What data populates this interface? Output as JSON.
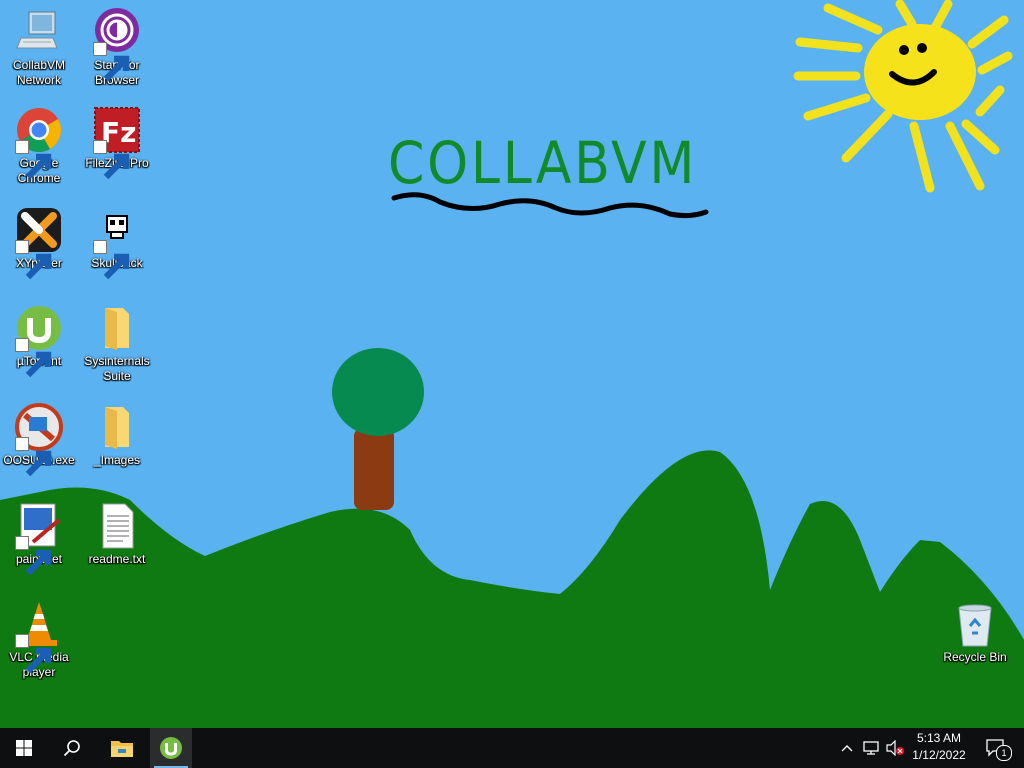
{
  "desktop": {
    "wallpaper_text": "COLLABVM",
    "icons": [
      {
        "label": "CollabVM Network",
        "icon": "network-computer-icon"
      },
      {
        "label": "Start Tor Browser",
        "icon": "tor-browser-icon"
      },
      {
        "label": "Google Chrome",
        "icon": "chrome-icon"
      },
      {
        "label": "FileZilla Pro",
        "icon": "filezilla-icon"
      },
      {
        "label": "XYplorer",
        "icon": "xyplorer-icon"
      },
      {
        "label": "Skullback",
        "icon": "skull-icon"
      },
      {
        "label": "µTorrent",
        "icon": "utorrent-icon"
      },
      {
        "label": "Sysinternals Suite",
        "icon": "folder-icon"
      },
      {
        "label": "OOSU10.exe",
        "icon": "oosu-icon"
      },
      {
        "label": "_Images",
        "icon": "folder-icon"
      },
      {
        "label": "paint.net",
        "icon": "paintnet-icon"
      },
      {
        "label": "readme.txt",
        "icon": "text-file-icon"
      },
      {
        "label": "VLC media player",
        "icon": "vlc-icon"
      },
      {
        "label": "Recycle Bin",
        "icon": "recycle-bin-icon"
      }
    ]
  },
  "taskbar": {
    "clock": {
      "time": "5:13 AM",
      "date": "1/12/2022"
    },
    "notification_count": "1",
    "pinned": [
      "start-icon",
      "search-icon",
      "file-explorer-icon",
      "utorrent-icon"
    ]
  },
  "colors": {
    "sky": "#5ab2f0",
    "hills": "#0f7a12",
    "taskbar": "#0d0f10",
    "sun": "#f6e21a",
    "title_text": "#138a2a"
  }
}
